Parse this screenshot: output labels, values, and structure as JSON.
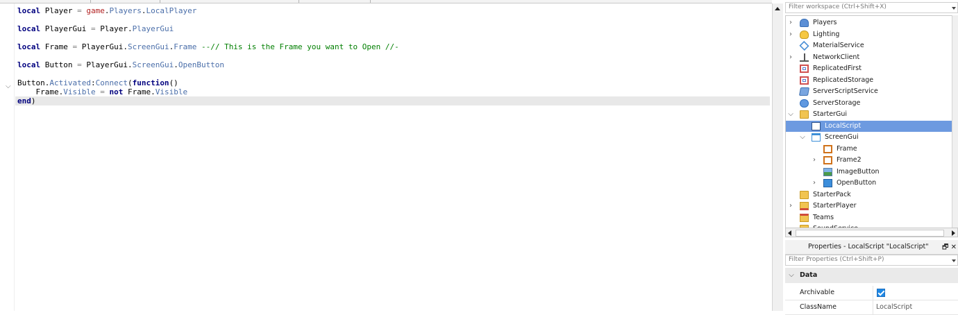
{
  "editor": {
    "lines": [
      [
        {
          "t": "local",
          "c": "kw"
        },
        {
          "t": " Player "
        },
        {
          "t": "=",
          "c": "op"
        },
        {
          "t": " "
        },
        {
          "t": "game",
          "c": "glob"
        },
        {
          "t": "."
        },
        {
          "t": "Players",
          "c": "prop"
        },
        {
          "t": "."
        },
        {
          "t": "LocalPlayer",
          "c": "prop"
        }
      ],
      [
        {
          "t": "local",
          "c": "kw"
        },
        {
          "t": " PlayerGui "
        },
        {
          "t": "=",
          "c": "op"
        },
        {
          "t": " Player."
        },
        {
          "t": "PlayerGui",
          "c": "prop"
        }
      ],
      [
        {
          "t": "local",
          "c": "kw"
        },
        {
          "t": " Frame "
        },
        {
          "t": "=",
          "c": "op"
        },
        {
          "t": " PlayerGui."
        },
        {
          "t": "ScreenGui",
          "c": "prop"
        },
        {
          "t": "."
        },
        {
          "t": "Frame",
          "c": "prop"
        },
        {
          "t": " "
        },
        {
          "t": "--// This is the Frame you want to Open //-",
          "c": "cmt"
        }
      ],
      [
        {
          "t": "local",
          "c": "kw"
        },
        {
          "t": " Button "
        },
        {
          "t": "=",
          "c": "op"
        },
        {
          "t": " PlayerGui."
        },
        {
          "t": "ScreenGui",
          "c": "prop"
        },
        {
          "t": "."
        },
        {
          "t": "OpenButton",
          "c": "prop"
        }
      ],
      [
        {
          "t": "Button."
        },
        {
          "t": "Activated",
          "c": "prop"
        },
        {
          "t": ":"
        },
        {
          "t": "Connect",
          "c": "prop"
        },
        {
          "t": "("
        },
        {
          "t": "function",
          "c": "kw"
        },
        {
          "t": "()"
        }
      ],
      [
        {
          "t": "    Frame."
        },
        {
          "t": "Visible",
          "c": "prop"
        },
        {
          "t": " "
        },
        {
          "t": "=",
          "c": "op"
        },
        {
          "t": " "
        },
        {
          "t": "not",
          "c": "kw"
        },
        {
          "t": " Frame."
        },
        {
          "t": "Visible",
          "c": "prop"
        }
      ],
      [
        {
          "t": "end",
          "c": "kw"
        },
        {
          "t": ")"
        }
      ]
    ]
  },
  "explorer": {
    "filter_placeholder": "Filter workspace (Ctrl+Shift+X)",
    "items": [
      {
        "label": "Players",
        "icon": "players-icon",
        "depth": 0,
        "expander": "collapsed"
      },
      {
        "label": "Lighting",
        "icon": "lighting-icon",
        "depth": 0,
        "expander": "collapsed"
      },
      {
        "label": "MaterialService",
        "icon": "material-service-icon",
        "depth": 0,
        "expander": "none"
      },
      {
        "label": "NetworkClient",
        "icon": "network-client-icon",
        "depth": 0,
        "expander": "collapsed"
      },
      {
        "label": "ReplicatedFirst",
        "icon": "replicated-first-icon",
        "depth": 0,
        "expander": "none"
      },
      {
        "label": "ReplicatedStorage",
        "icon": "replicated-storage-icon",
        "depth": 0,
        "expander": "none"
      },
      {
        "label": "ServerScriptService",
        "icon": "server-script-service-icon",
        "depth": 0,
        "expander": "none"
      },
      {
        "label": "ServerStorage",
        "icon": "server-storage-icon",
        "depth": 0,
        "expander": "none"
      },
      {
        "label": "StarterGui",
        "icon": "starter-gui-icon",
        "depth": 0,
        "expander": "expanded"
      },
      {
        "label": "LocalScript",
        "icon": "local-script-icon",
        "depth": 1,
        "expander": "none",
        "selected": true
      },
      {
        "label": "ScreenGui",
        "icon": "screen-gui-icon",
        "depth": 1,
        "expander": "expanded"
      },
      {
        "label": "Frame",
        "icon": "frame-icon",
        "depth": 2,
        "expander": "none"
      },
      {
        "label": "Frame2",
        "icon": "frame-icon",
        "depth": 2,
        "expander": "collapsed"
      },
      {
        "label": "ImageButton",
        "icon": "image-button-icon",
        "depth": 2,
        "expander": "none"
      },
      {
        "label": "OpenButton",
        "icon": "text-button-icon",
        "depth": 2,
        "expander": "collapsed"
      },
      {
        "label": "StarterPack",
        "icon": "starter-pack-icon",
        "depth": 0,
        "expander": "none"
      },
      {
        "label": "StarterPlayer",
        "icon": "starter-player-icon",
        "depth": 0,
        "expander": "collapsed"
      },
      {
        "label": "Teams",
        "icon": "teams-icon",
        "depth": 0,
        "expander": "none"
      },
      {
        "label": "SoundService",
        "icon": "sound-service-icon",
        "depth": 0,
        "expander": "none"
      }
    ]
  },
  "properties": {
    "title": "Properties - LocalScript \"LocalScript\"",
    "filter_placeholder": "Filter Properties (Ctrl+Shift+P)",
    "category": "Data",
    "rows": {
      "archivable": {
        "name": "Archivable",
        "checked": true
      },
      "classname": {
        "name": "ClassName",
        "value": "LocalScript"
      }
    }
  }
}
